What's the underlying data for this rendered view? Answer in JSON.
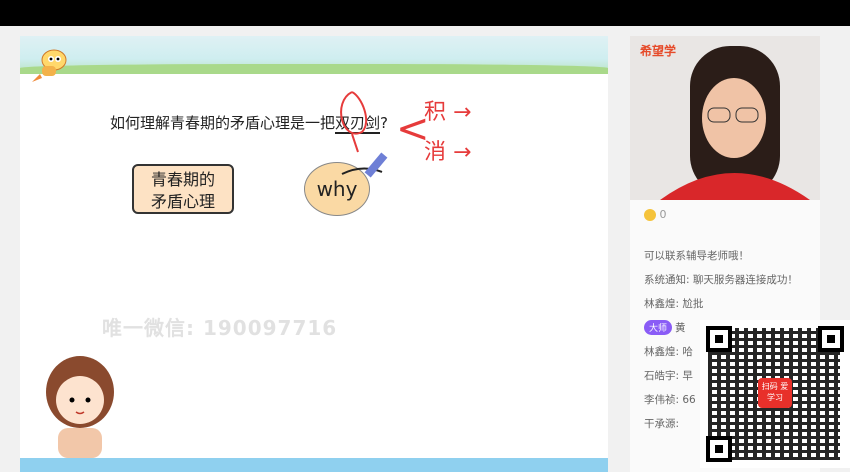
{
  "slide": {
    "question_prefix": "如何理解青春期的矛盾心理是一把",
    "question_highlight": "双刃剑",
    "question_suffix": "?",
    "label_line1": "青春期的",
    "label_line2": "矛盾心理",
    "why_bubble": "why",
    "watermark": "唯一微信: 190097716"
  },
  "annotations": {
    "bracket": "<",
    "pos": "积 →",
    "neg": "消 →"
  },
  "side": {
    "brand": "希望学",
    "coin_count": "0",
    "chat": [
      {
        "text": "可以联系辅导老师哦！"
      },
      {
        "text": "系统通知: 聊天服务器连接成功！"
      },
      {
        "text": "林鑫煌: 尬批"
      },
      {
        "badge": "大师",
        "text": "黄"
      },
      {
        "text": "林鑫煌: 哈"
      },
      {
        "text": "石皓宇: 早"
      },
      {
        "text": "李伟祯: 66"
      },
      {
        "text": "干承源:"
      }
    ],
    "qr_logo": "扫码 爱学习"
  },
  "colors": {
    "accent": "#e64b2a",
    "annotation": "#e63b3b",
    "label_fill": "#fde2c4",
    "why_fill": "#fad9a4"
  }
}
